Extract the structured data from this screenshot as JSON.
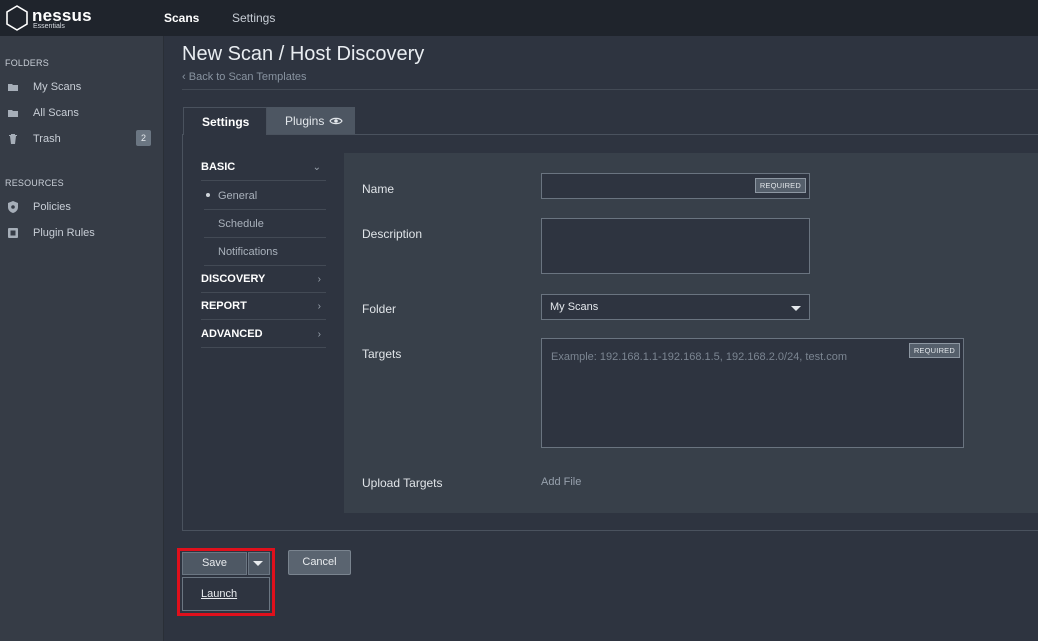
{
  "header": {
    "logo_name": "nessus",
    "logo_sub": "Essentials",
    "nav": [
      {
        "label": "Scans",
        "active": true
      },
      {
        "label": "Settings",
        "active": false
      }
    ]
  },
  "sidebar": {
    "folders_heading": "FOLDERS",
    "folders": [
      {
        "label": "My Scans",
        "icon": "folder-icon"
      },
      {
        "label": "All Scans",
        "icon": "folder-icon"
      },
      {
        "label": "Trash",
        "icon": "trash-icon",
        "badge": "2"
      }
    ],
    "resources_heading": "RESOURCES",
    "resources": [
      {
        "label": "Policies",
        "icon": "policy-icon"
      },
      {
        "label": "Plugin Rules",
        "icon": "plugin-rules-icon"
      }
    ]
  },
  "main": {
    "title": "New Scan / Host Discovery",
    "back_link": "Back to Scan Templates",
    "tabs": [
      {
        "label": "Settings",
        "active": true
      },
      {
        "label": "Plugins",
        "active": false
      }
    ],
    "sections": [
      {
        "label": "BASIC",
        "expanded": true,
        "items": [
          "General",
          "Schedule",
          "Notifications"
        ],
        "selected": "General"
      },
      {
        "label": "DISCOVERY",
        "expanded": false
      },
      {
        "label": "REPORT",
        "expanded": false
      },
      {
        "label": "ADVANCED",
        "expanded": false
      }
    ],
    "form": {
      "name_label": "Name",
      "name_value": "",
      "required_tag": "REQUIRED",
      "description_label": "Description",
      "description_value": "",
      "folder_label": "Folder",
      "folder_value": "My Scans",
      "targets_label": "Targets",
      "targets_placeholder": "Example: 192.168.1.1-192.168.1.5, 192.168.2.0/24, test.com",
      "upload_label": "Upload Targets",
      "upload_link": "Add File"
    },
    "actions": {
      "save": "Save",
      "launch": "Launch",
      "cancel": "Cancel"
    }
  },
  "colors": {
    "background": "#2e3440",
    "topbar": "#1f242c",
    "sidebar": "#363c46",
    "highlight": "#e0101c"
  }
}
